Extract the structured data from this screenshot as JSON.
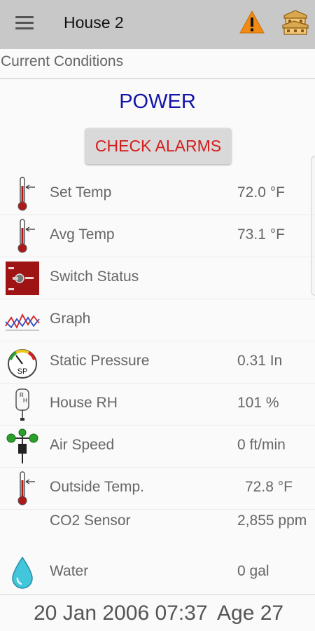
{
  "header": {
    "title": "House 2",
    "menu_icon": "hamburger-menu-icon",
    "alarm_icon": "warning-triangle-icon",
    "settings_icon": "chicken-house-icon"
  },
  "section": {
    "title": "Current Conditions"
  },
  "status": {
    "power": "POWER",
    "check_alarms": "CHECK ALARMS",
    "power_color": "#1414a8",
    "alarm_color": "#d41c1c"
  },
  "rows": [
    {
      "label": "Set Temp",
      "value": "72.0 °F",
      "icon": "thermometer-icon"
    },
    {
      "label": "Avg Temp",
      "value": "73.1 °F",
      "icon": "thermometer-icon"
    },
    {
      "label": "Switch Status",
      "value": "",
      "icon": "switch-panel-icon"
    },
    {
      "label": "Graph",
      "value": "",
      "icon": "graph-icon"
    },
    {
      "label": "Static Pressure",
      "value": "0.31 In",
      "icon": "pressure-gauge-icon"
    },
    {
      "label": "House RH",
      "value": "101 %",
      "icon": "humidity-sensor-icon"
    },
    {
      "label": "Air Speed",
      "value": "0 ft/min",
      "icon": "anemometer-icon"
    },
    {
      "label": "Outside Temp.",
      "value": "72.8 °F",
      "icon": "thermometer-icon"
    },
    {
      "label": "CO2 Sensor",
      "value": "2,855 ppm",
      "icon": ""
    },
    {
      "label": "Water",
      "value": "0 gal",
      "icon": "water-drop-icon"
    }
  ],
  "footer": {
    "datetime": "20 Jan 2006 07:37",
    "age": "Age 27"
  }
}
